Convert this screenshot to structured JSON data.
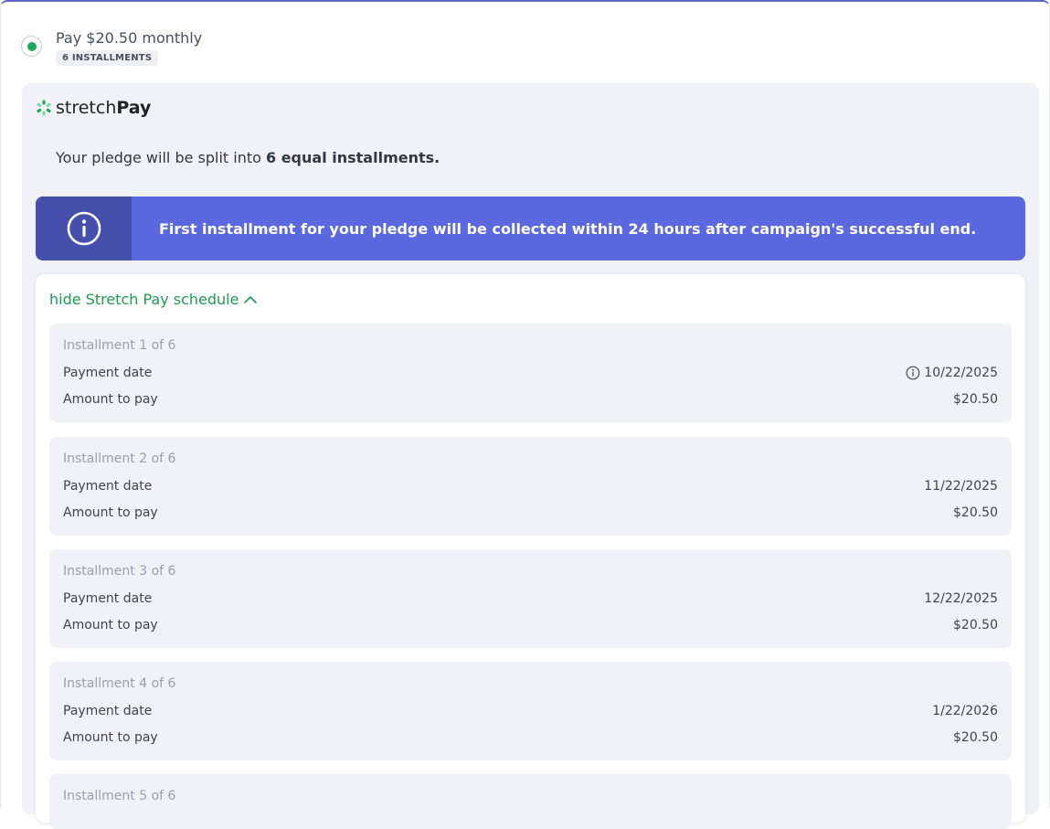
{
  "option": {
    "title": "Pay $20.50 monthly",
    "badge": "6 INSTALLMENTS",
    "selected": true,
    "accent": "#1eaa5b"
  },
  "brand": {
    "light": "stretch",
    "bold": "Pay",
    "icon": "stretchpay-logo-icon"
  },
  "split": {
    "prefix": "Your pledge will be split into ",
    "emphasis": "6 equal installments."
  },
  "banner": {
    "text": "First installment for your pledge will be collected within 24 hours after campaign's successful end.",
    "icon": "info-circle-icon",
    "color": "#5b68e0"
  },
  "schedule": {
    "toggle_label": "hide Stretch Pay schedule",
    "installments": [
      {
        "title": "Installment 1 of 6",
        "date_label": "Payment date",
        "date": "10/22/2025",
        "amount_label": "Amount to pay",
        "amount": "$20.50"
      },
      {
        "title": "Installment 2 of 6",
        "date_label": "Payment date",
        "date": "11/22/2025",
        "amount_label": "Amount to pay",
        "amount": "$20.50"
      },
      {
        "title": "Installment 3 of 6",
        "date_label": "Payment date",
        "date": "12/22/2025",
        "amount_label": "Amount to pay",
        "amount": "$20.50"
      },
      {
        "title": "Installment 4 of 6",
        "date_label": "Payment date",
        "date": "1/22/2026",
        "amount_label": "Amount to pay",
        "amount": "$20.50"
      },
      {
        "title": "Installment 5 of 6"
      }
    ]
  }
}
